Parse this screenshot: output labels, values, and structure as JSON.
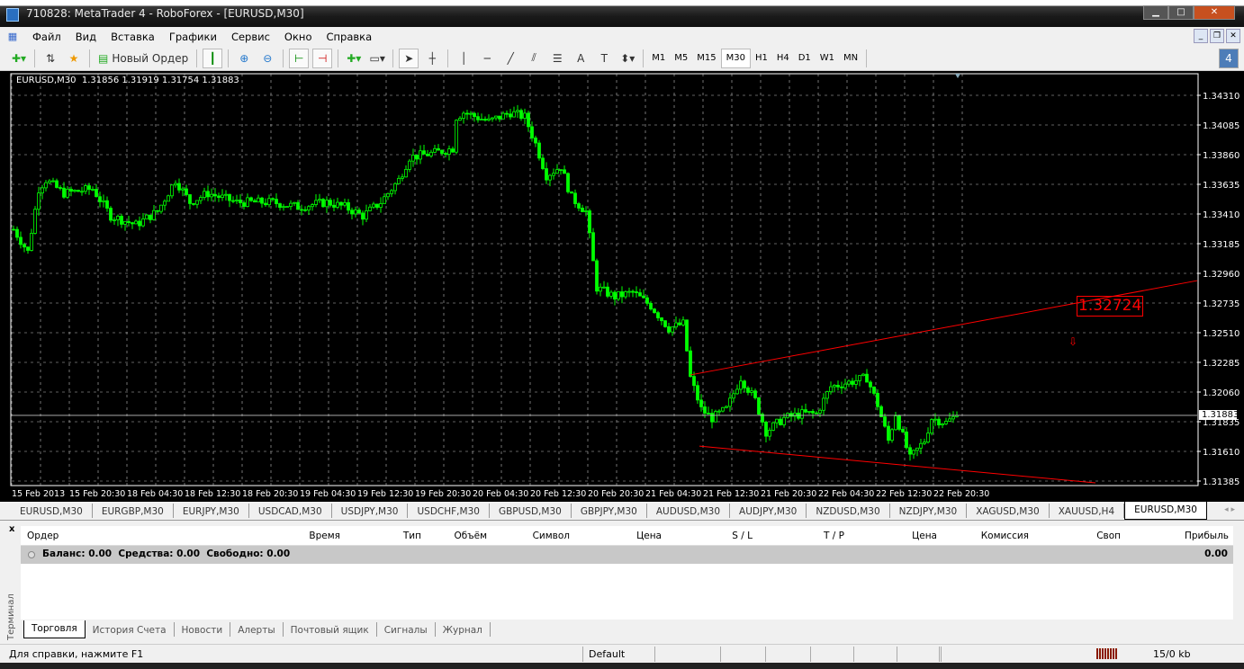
{
  "window": {
    "title": "710828: MetaTrader 4 - RoboForex - [EURUSD,M30]"
  },
  "menu": [
    "Файл",
    "Вид",
    "Вставка",
    "Графики",
    "Сервис",
    "Окно",
    "Справка"
  ],
  "toolbar": {
    "new_order": "Новый Ордер",
    "timeframes": [
      "M1",
      "M5",
      "M15",
      "M30",
      "H1",
      "H4",
      "D1",
      "W1",
      "MN"
    ],
    "active_timeframe": "M30",
    "notifications": "4",
    "text_tool": "A"
  },
  "chart": {
    "info": "EURUSD,M30  1.31856 1.31919 1.31754 1.31883",
    "bid_label": "1.31883",
    "trend_label": "1.32724"
  },
  "chart_data": {
    "type": "candlestick",
    "symbol": "EURUSD",
    "timeframe": "M30",
    "ylim": [
      1.31385,
      1.3431
    ],
    "yticks": [
      "1.34310",
      "1.34085",
      "1.33860",
      "1.33635",
      "1.33410",
      "1.33185",
      "1.32960",
      "1.32735",
      "1.32510",
      "1.32285",
      "1.32060",
      "1.31835",
      "1.31610",
      "1.31385"
    ],
    "xticks": [
      "15 Feb 2013",
      "15 Feb 20:30",
      "18 Feb 04:30",
      "18 Feb 12:30",
      "18 Feb 20:30",
      "19 Feb 04:30",
      "19 Feb 12:30",
      "19 Feb 20:30",
      "20 Feb 04:30",
      "20 Feb 12:30",
      "20 Feb 20:30",
      "21 Feb 04:30",
      "21 Feb 12:30",
      "21 Feb 20:30",
      "22 Feb 04:30",
      "22 Feb 12:30",
      "22 Feb 20:30"
    ],
    "bars_per_xtick": 16,
    "total_slots": 329,
    "close_path": [
      [
        0,
        1.33294
      ],
      [
        4,
        1.33123
      ],
      [
        7,
        1.33601
      ],
      [
        9,
        1.33669
      ],
      [
        14,
        1.33567
      ],
      [
        22,
        1.33601
      ],
      [
        27,
        1.33396
      ],
      [
        34,
        1.33328
      ],
      [
        40,
        1.3343
      ],
      [
        45,
        1.33669
      ],
      [
        49,
        1.33499
      ],
      [
        54,
        1.33567
      ],
      [
        62,
        1.33499
      ],
      [
        72,
        1.33499
      ],
      [
        79,
        1.33464
      ],
      [
        87,
        1.33499
      ],
      [
        92,
        1.33464
      ],
      [
        97,
        1.33396
      ],
      [
        102,
        1.33499
      ],
      [
        107,
        1.33669
      ],
      [
        110,
        1.3384
      ],
      [
        117,
        1.33874
      ],
      [
        122,
        1.33908
      ],
      [
        123,
        1.34146
      ],
      [
        125,
        1.3418
      ],
      [
        132,
        1.34112
      ],
      [
        138,
        1.3418
      ],
      [
        142,
        1.34146
      ],
      [
        145,
        1.33942
      ],
      [
        148,
        1.33703
      ],
      [
        152,
        1.33771
      ],
      [
        155,
        1.33533
      ],
      [
        159,
        1.3343
      ],
      [
        162,
        1.32851
      ],
      [
        167,
        1.32782
      ],
      [
        172,
        1.32816
      ],
      [
        177,
        1.32714
      ],
      [
        182,
        1.32544
      ],
      [
        186,
        1.32578
      ],
      [
        188,
        1.32169
      ],
      [
        191,
        1.3193
      ],
      [
        194,
        1.31862
      ],
      [
        198,
        1.3193
      ],
      [
        202,
        1.32169
      ],
      [
        206,
        1.31998
      ],
      [
        209,
        1.3176
      ],
      [
        214,
        1.31862
      ],
      [
        219,
        1.31896
      ],
      [
        223,
        1.31896
      ],
      [
        227,
        1.321
      ],
      [
        232,
        1.32134
      ],
      [
        237,
        1.32169
      ],
      [
        240,
        1.31964
      ],
      [
        243,
        1.31691
      ],
      [
        245,
        1.31896
      ],
      [
        249,
        1.31555
      ],
      [
        253,
        1.31691
      ],
      [
        255,
        1.31862
      ],
      [
        259,
        1.31828
      ],
      [
        262,
        1.31883
      ]
    ],
    "trendlines": [
      {
        "from": [
          188,
          1.3219
        ],
        "to": [
          329,
          1.32905
        ],
        "color": "#ff0000"
      },
      {
        "from": [
          190.5,
          1.3165
        ],
        "to": [
          300.5,
          1.31371
        ],
        "color": "#ff0000"
      }
    ],
    "arrow": {
      "bar": 294,
      "price": 1.32441,
      "direction": "down"
    },
    "bid": 1.31883,
    "colors": {
      "candle": "#00ff00",
      "grid": "#c0c0c0",
      "background": "#000000",
      "bid_line": "#c0c0c0"
    }
  },
  "symbol_tabs": [
    "EURUSD,M30",
    "EURGBP,M30",
    "EURJPY,M30",
    "USDCAD,M30",
    "USDJPY,M30",
    "USDCHF,M30",
    "GBPUSD,M30",
    "GBPJPY,M30",
    "AUDUSD,M30",
    "AUDJPY,M30",
    "NZDUSD,M30",
    "NZDJPY,M30",
    "XAGUSD,M30",
    "XAUUSD,H4",
    "EURUSD,M30"
  ],
  "terminal": {
    "side_label": "Терминал",
    "columns": [
      "Ордер",
      "Время",
      "Тип",
      "Объём",
      "Символ",
      "Цена",
      "S / L",
      "T / P",
      "Цена",
      "Комиссия",
      "Своп",
      "Прибыль"
    ],
    "balance": "Баланс: 0.00  Средства: 0.00  Свободно: 0.00",
    "profit": "0.00",
    "tabs": [
      "Торговля",
      "История Счета",
      "Новости",
      "Алерты",
      "Почтовый ящик",
      "Сигналы",
      "Журнал"
    ]
  },
  "status": {
    "help": "Для справки, нажмите F1",
    "profile": "Default",
    "traffic": "15/0 kb"
  }
}
